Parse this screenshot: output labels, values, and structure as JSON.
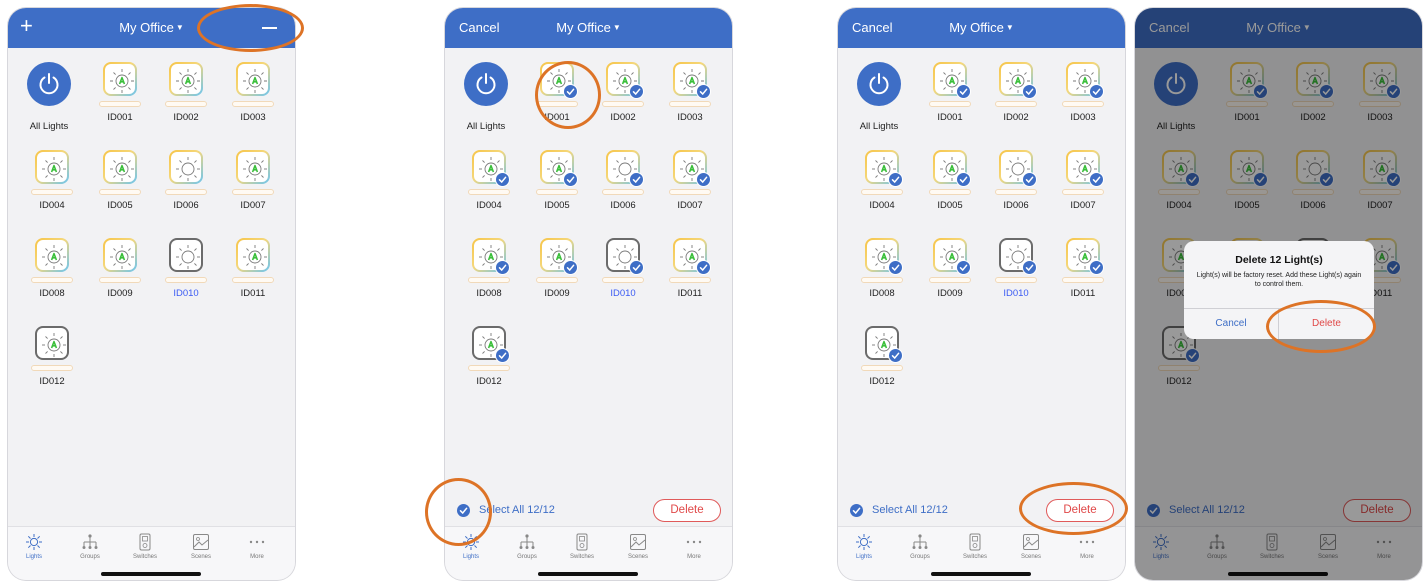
{
  "accent_color": "#3e6ec6",
  "delete_color": "#e04848",
  "highlight_color": "#dd7326",
  "nav": {
    "title": "My Office",
    "cancel": "Cancel"
  },
  "all_lights_label": "All Lights",
  "lights": [
    {
      "label": "ID001",
      "state": "on"
    },
    {
      "label": "ID002",
      "state": "on"
    },
    {
      "label": "ID003",
      "state": "on"
    },
    {
      "label": "ID004",
      "state": "on"
    },
    {
      "label": "ID005",
      "state": "on"
    },
    {
      "label": "ID006",
      "state": "idle"
    },
    {
      "label": "ID007",
      "state": "on"
    },
    {
      "label": "ID008",
      "state": "on"
    },
    {
      "label": "ID009",
      "state": "on"
    },
    {
      "label": "ID010",
      "state": "offline"
    },
    {
      "label": "ID011",
      "state": "on"
    },
    {
      "label": "ID012",
      "state": "on-gray"
    }
  ],
  "selection": {
    "select_all": "Select All 12/12",
    "delete": "Delete"
  },
  "tabs": [
    {
      "label": "Lights",
      "icon": "bulb-icon"
    },
    {
      "label": "Groups",
      "icon": "groups-icon"
    },
    {
      "label": "Switches",
      "icon": "switch-icon"
    },
    {
      "label": "Scenes",
      "icon": "scenes-icon"
    },
    {
      "label": "More",
      "icon": "more-icon"
    }
  ],
  "dialog": {
    "title": "Delete 12 Light(s)",
    "message": "Light(s) will be factory reset. Add these Light(s) again to control them.",
    "cancel": "Cancel",
    "delete": "Delete"
  },
  "screens": [
    {
      "mode": "normal"
    },
    {
      "mode": "edit"
    },
    {
      "mode": "edit"
    },
    {
      "mode": "edit-dialog"
    }
  ]
}
